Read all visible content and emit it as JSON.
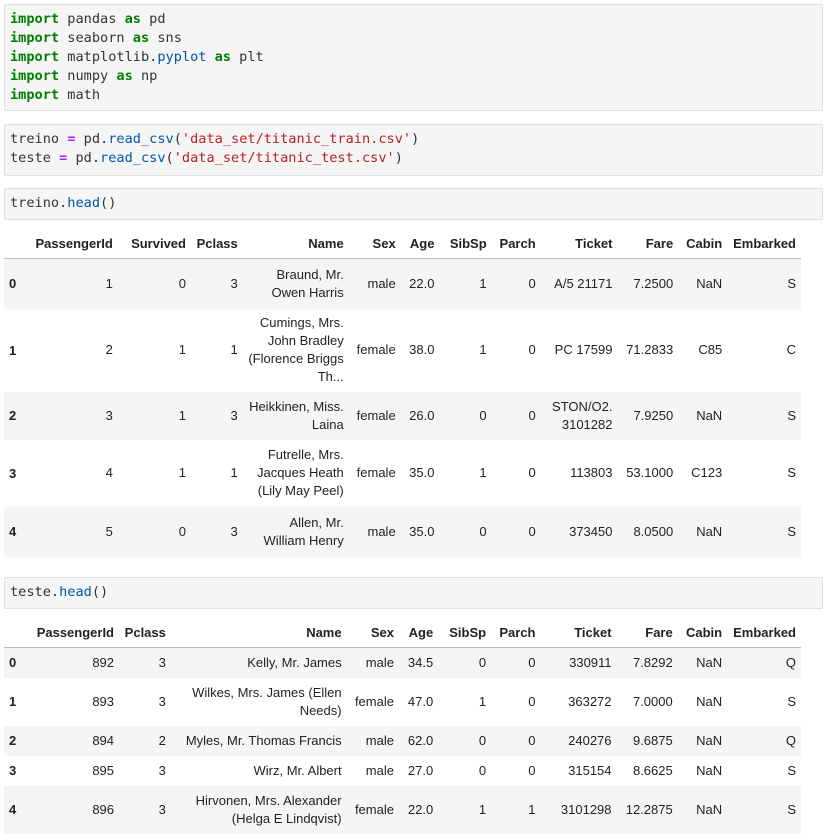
{
  "cells": [
    {
      "lines": [
        [
          {
            "t": "import",
            "c": "kw"
          },
          {
            "t": " pandas "
          },
          {
            "t": "as",
            "c": "kw"
          },
          {
            "t": " pd"
          }
        ],
        [
          {
            "t": "import",
            "c": "kw"
          },
          {
            "t": " seaborn "
          },
          {
            "t": "as",
            "c": "kw"
          },
          {
            "t": " sns"
          }
        ],
        [
          {
            "t": "import",
            "c": "kw"
          },
          {
            "t": " matplotlib."
          },
          {
            "t": "pyplot",
            "c": "attr"
          },
          {
            "t": " "
          },
          {
            "t": "as",
            "c": "kw"
          },
          {
            "t": " plt"
          }
        ],
        [
          {
            "t": "import",
            "c": "kw"
          },
          {
            "t": " numpy "
          },
          {
            "t": "as",
            "c": "kw"
          },
          {
            "t": " np"
          }
        ],
        [
          {
            "t": "import",
            "c": "kw"
          },
          {
            "t": " math"
          }
        ]
      ]
    },
    {
      "lines": [
        [
          {
            "t": "treino "
          },
          {
            "t": "=",
            "c": "op"
          },
          {
            "t": " pd."
          },
          {
            "t": "read_csv",
            "c": "attr"
          },
          {
            "t": "("
          },
          {
            "t": "'data_set/titanic_train.csv'",
            "c": "str"
          },
          {
            "t": ")"
          }
        ],
        [
          {
            "t": "teste "
          },
          {
            "t": "=",
            "c": "op"
          },
          {
            "t": " pd."
          },
          {
            "t": "read_csv",
            "c": "attr"
          },
          {
            "t": "("
          },
          {
            "t": "'data_set/titanic_test.csv'",
            "c": "str"
          },
          {
            "t": ")"
          }
        ]
      ]
    },
    {
      "lines": [
        [
          {
            "t": "treino."
          },
          {
            "t": "head",
            "c": "attr"
          },
          {
            "t": "()"
          }
        ]
      ]
    },
    {
      "lines": [
        [
          {
            "t": "teste."
          },
          {
            "t": "head",
            "c": "attr"
          },
          {
            "t": "()"
          }
        ]
      ]
    }
  ],
  "train_table": {
    "columns": [
      "",
      "PassengerId",
      "Survived",
      "Pclass",
      "Name",
      "Sex",
      "Age",
      "SibSp",
      "Parch",
      "Ticket",
      "Fare",
      "Cabin",
      "Embarked"
    ],
    "rows": [
      [
        "0",
        "1",
        "0",
        "3",
        "Braund, Mr. Owen Harris",
        "male",
        "22.0",
        "1",
        "0",
        "A/5 21171",
        "7.2500",
        "NaN",
        "S"
      ],
      [
        "1",
        "2",
        "1",
        "1",
        "Cumings, Mrs. John Bradley (Florence Briggs Th...",
        "female",
        "38.0",
        "1",
        "0",
        "PC 17599",
        "71.2833",
        "C85",
        "C"
      ],
      [
        "2",
        "3",
        "1",
        "3",
        "Heikkinen, Miss. Laina",
        "female",
        "26.0",
        "0",
        "0",
        "STON/O2. 3101282",
        "7.9250",
        "NaN",
        "S"
      ],
      [
        "3",
        "4",
        "1",
        "1",
        "Futrelle, Mrs. Jacques Heath (Lily May Peel)",
        "female",
        "35.0",
        "1",
        "0",
        "113803",
        "53.1000",
        "C123",
        "S"
      ],
      [
        "4",
        "5",
        "0",
        "3",
        "Allen, Mr. William Henry",
        "male",
        "35.0",
        "0",
        "0",
        "373450",
        "8.0500",
        "NaN",
        "S"
      ]
    ]
  },
  "test_table": {
    "columns": [
      "",
      "PassengerId",
      "Pclass",
      "Name",
      "Sex",
      "Age",
      "SibSp",
      "Parch",
      "Ticket",
      "Fare",
      "Cabin",
      "Embarked"
    ],
    "rows": [
      [
        "0",
        "892",
        "3",
        "Kelly, Mr. James",
        "male",
        "34.5",
        "0",
        "0",
        "330911",
        "7.8292",
        "NaN",
        "Q"
      ],
      [
        "1",
        "893",
        "3",
        "Wilkes, Mrs. James (Ellen Needs)",
        "female",
        "47.0",
        "1",
        "0",
        "363272",
        "7.0000",
        "NaN",
        "S"
      ],
      [
        "2",
        "894",
        "2",
        "Myles, Mr. Thomas Francis",
        "male",
        "62.0",
        "0",
        "0",
        "240276",
        "9.6875",
        "NaN",
        "Q"
      ],
      [
        "3",
        "895",
        "3",
        "Wirz, Mr. Albert",
        "male",
        "27.0",
        "0",
        "0",
        "315154",
        "8.6625",
        "NaN",
        "S"
      ],
      [
        "4",
        "896",
        "3",
        "Hirvonen, Mrs. Alexander (Helga E Lindqvist)",
        "female",
        "22.0",
        "1",
        "1",
        "3101298",
        "12.2875",
        "NaN",
        "S"
      ]
    ]
  }
}
